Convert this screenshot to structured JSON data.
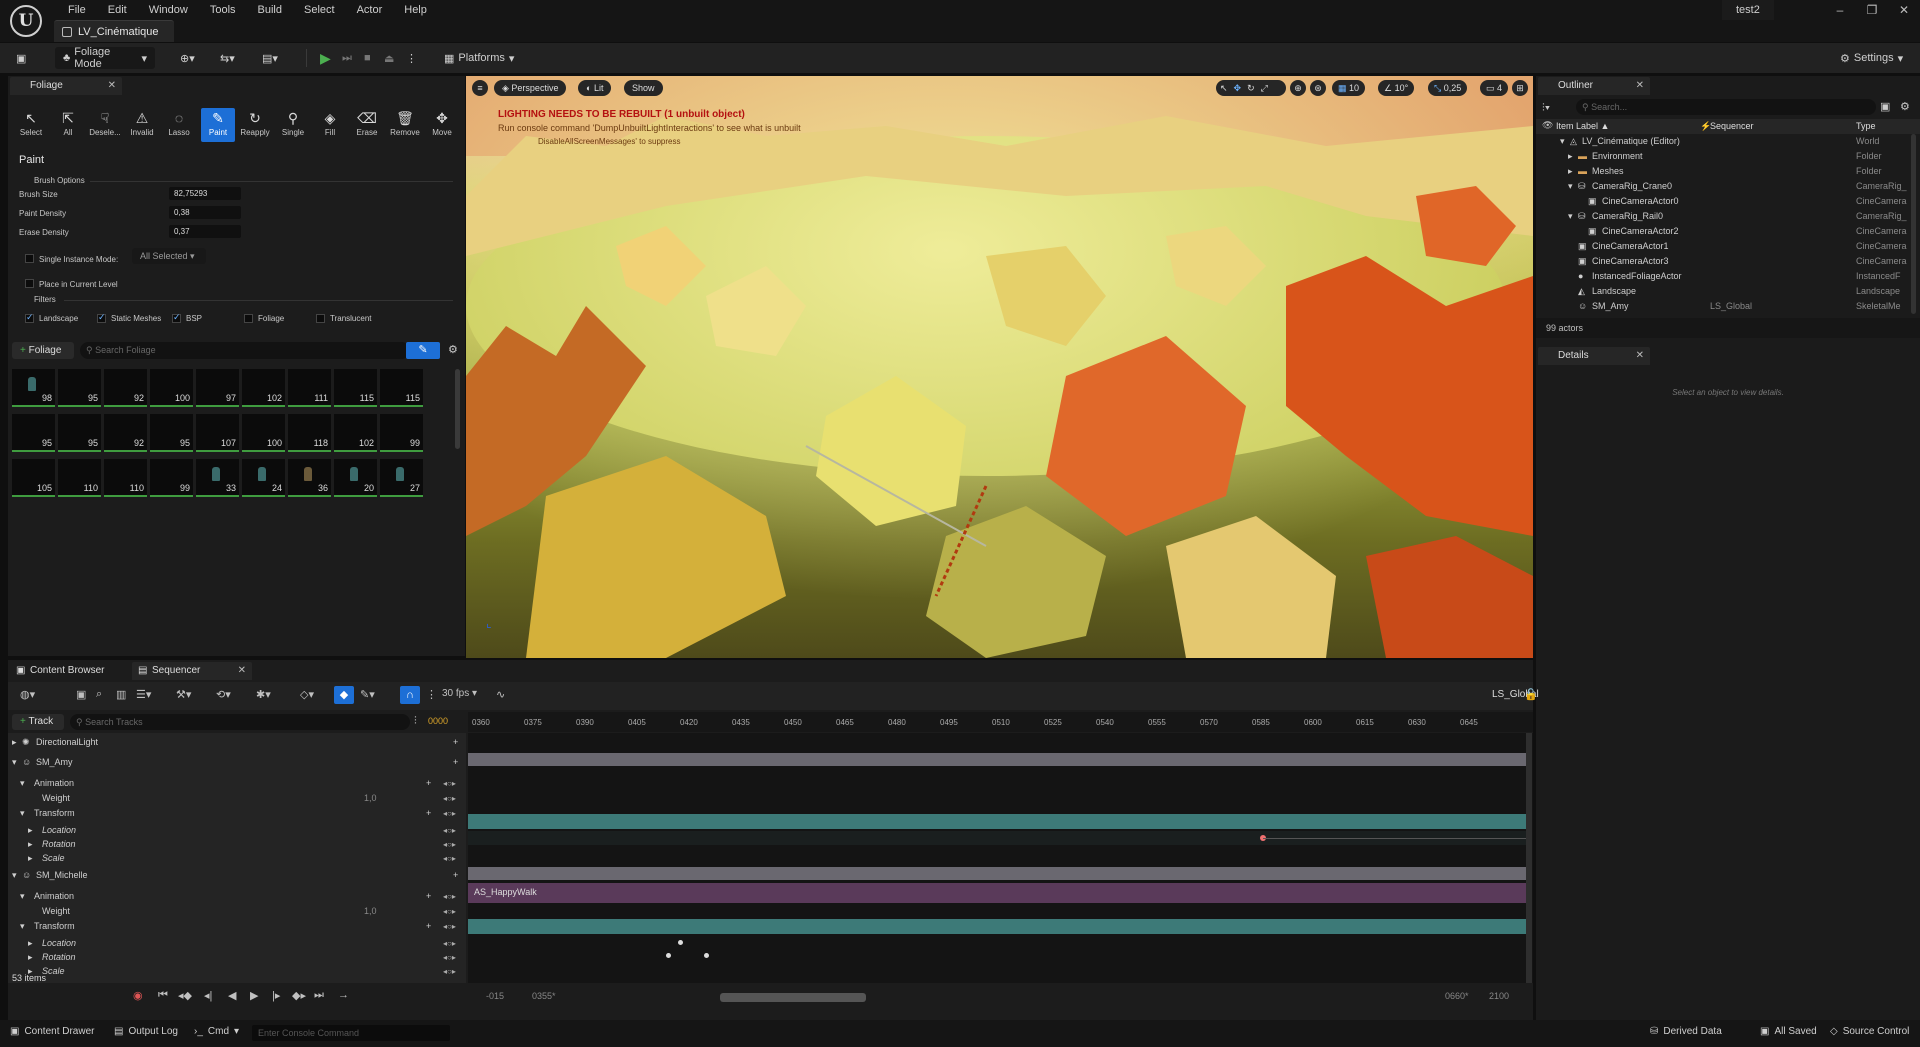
{
  "app": {
    "tab": "LV_Cinématique",
    "project": "test2"
  },
  "menu": [
    "File",
    "Edit",
    "Window",
    "Tools",
    "Build",
    "Select",
    "Actor",
    "Help"
  ],
  "toolbar": {
    "mode": "Foliage Mode",
    "platforms": "Platforms",
    "settings": "Settings"
  },
  "foliage": {
    "tab": "Foliage",
    "tools": [
      "Select",
      "All",
      "Desele...",
      "Invalid",
      "Lasso",
      "Paint",
      "Reapply",
      "Single",
      "Fill",
      "Erase",
      "Remove",
      "Move"
    ],
    "section": "Paint",
    "brush_options": "Brush Options",
    "brush_size_label": "Brush Size",
    "brush_size": "82,75293",
    "paint_density_label": "Paint Density",
    "paint_density": "0,38",
    "erase_density_label": "Erase Density",
    "erase_density": "0,37",
    "single_instance": "Single Instance Mode:",
    "single_instance_value": "All Selected",
    "place_current": "Place in Current Level",
    "filters": "Filters",
    "filter_items": [
      "Landscape",
      "Static Meshes",
      "BSP",
      "Foliage",
      "Translucent"
    ],
    "add_button": "Foliage",
    "search_placeholder": "Search Foliage",
    "grid": [
      [
        "98",
        "95",
        "92",
        "100",
        "97",
        "102",
        "111",
        "115",
        "115"
      ],
      [
        "95",
        "95",
        "92",
        "95",
        "107",
        "100",
        "118",
        "102",
        "99"
      ],
      [
        "105",
        "110",
        "110",
        "99",
        "33",
        "24",
        "36",
        "20",
        "27"
      ]
    ]
  },
  "viewport": {
    "perspective": "Perspective",
    "lit": "Lit",
    "show": "Show",
    "warn1": "LIGHTING NEEDS TO BE REBUILT (1 unbuilt object)",
    "warn2": "Run console command 'DumpUnbuiltLightInteractions' to see what is unbuilt",
    "warn3": "DisableAllScreenMessages' to suppress",
    "grid_snap": "10",
    "rot_snap": "10°",
    "scale_snap": "0,25",
    "cam_speed": "4"
  },
  "outliner": {
    "tab": "Outliner",
    "search_placeholder": "Search...",
    "col_label": "Item Label ▲",
    "col_seq": "Sequencer",
    "col_type": "Type",
    "rows": [
      {
        "label": "LV_Cinématique (Editor)",
        "seq": "",
        "type": "World"
      },
      {
        "label": "Environment",
        "seq": "",
        "type": "Folder"
      },
      {
        "label": "Meshes",
        "seq": "",
        "type": "Folder"
      },
      {
        "label": "CameraRig_Crane0",
        "seq": "",
        "type": "CameraRig_"
      },
      {
        "label": "CineCameraActor0",
        "seq": "",
        "type": "CineCamera"
      },
      {
        "label": "CameraRig_Rail0",
        "seq": "",
        "type": "CameraRig_"
      },
      {
        "label": "CineCameraActor2",
        "seq": "",
        "type": "CineCamera"
      },
      {
        "label": "CineCameraActor1",
        "seq": "",
        "type": "CineCamera"
      },
      {
        "label": "CineCameraActor3",
        "seq": "",
        "type": "CineCamera"
      },
      {
        "label": "InstancedFoliageActor",
        "seq": "",
        "type": "InstancedF"
      },
      {
        "label": "Landscape",
        "seq": "",
        "type": "Landscape"
      },
      {
        "label": "SM_Amy",
        "seq": "LS_Global",
        "type": "SkeletalMe"
      }
    ],
    "count": "99 actors"
  },
  "details": {
    "tab": "Details",
    "empty": "Select an object to view details."
  },
  "sequencer": {
    "tabs": [
      "Content Browser",
      "Sequencer"
    ],
    "fps": "30 fps",
    "sequence": "LS_Global",
    "track_button": "Track",
    "search_placeholder": "Search Tracks",
    "frame": "0000",
    "ticks": [
      "0360",
      "0375",
      "0390",
      "0405",
      "0420",
      "0435",
      "0450",
      "0465",
      "0480",
      "0495",
      "0510",
      "0525",
      "0540",
      "0555",
      "0570",
      "0585",
      "0600",
      "0615",
      "0630",
      "0645"
    ],
    "tracks": [
      {
        "label": "DirectionalLight",
        "indent": 0,
        "value": ""
      },
      {
        "label": "SM_Amy",
        "indent": 0,
        "value": ""
      },
      {
        "label": "Animation",
        "indent": 1,
        "value": ""
      },
      {
        "label": "Weight",
        "indent": 2,
        "value": "1,0"
      },
      {
        "label": "Transform",
        "indent": 1,
        "value": ""
      },
      {
        "label": "Location",
        "indent": 2,
        "value": ""
      },
      {
        "label": "Rotation",
        "indent": 2,
        "value": ""
      },
      {
        "label": "Scale",
        "indent": 2,
        "value": ""
      },
      {
        "label": "SM_Michelle",
        "indent": 0,
        "value": ""
      },
      {
        "label": "Animation",
        "indent": 1,
        "value": ""
      },
      {
        "label": "Weight",
        "indent": 2,
        "value": "1,0"
      },
      {
        "label": "Transform",
        "indent": 1,
        "value": ""
      },
      {
        "label": "Location",
        "indent": 2,
        "value": ""
      },
      {
        "label": "Rotation",
        "indent": 2,
        "value": ""
      },
      {
        "label": "Scale",
        "indent": 2,
        "value": ""
      }
    ],
    "clip": "AS_HappyWalk",
    "items_count": "53 items",
    "range_start": "-015",
    "range_in": "0355*",
    "range_out": "0660*",
    "range_end": "2100"
  },
  "status": {
    "content_drawer": "Content Drawer",
    "output_log": "Output Log",
    "cmd": "Cmd",
    "console_placeholder": "Enter Console Command",
    "derived": "Derived Data",
    "saved": "All Saved",
    "source": "Source Control"
  }
}
